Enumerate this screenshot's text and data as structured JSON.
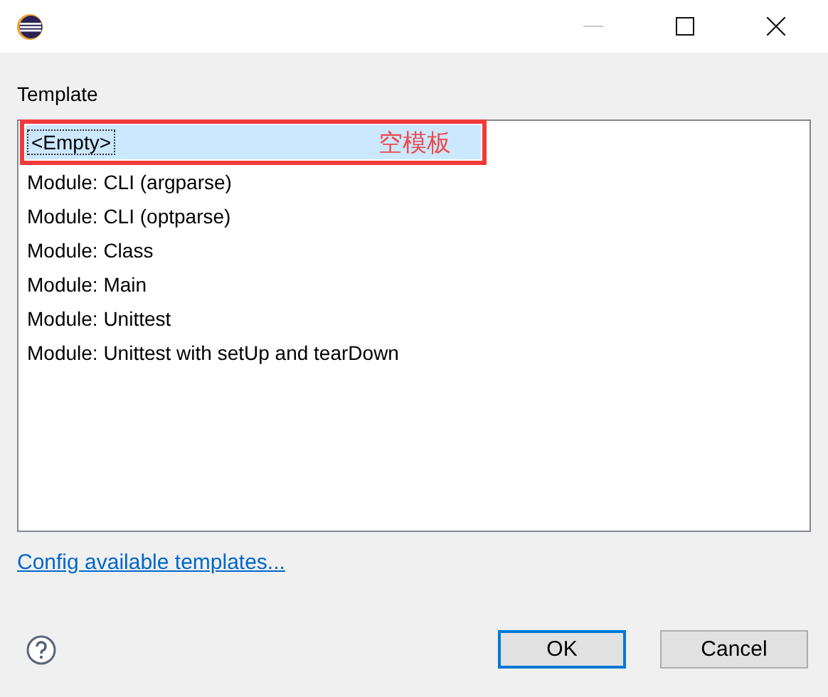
{
  "template_label": "Template",
  "templates": [
    {
      "label": "<Empty>",
      "selected": true
    },
    {
      "label": "Module: CLI (argparse)",
      "selected": false
    },
    {
      "label": "Module: CLI (optparse)",
      "selected": false
    },
    {
      "label": "Module: Class",
      "selected": false
    },
    {
      "label": "Module: Main",
      "selected": false
    },
    {
      "label": "Module: Unittest",
      "selected": false
    },
    {
      "label": "Module: Unittest with setUp and tearDown",
      "selected": false
    }
  ],
  "annotation": {
    "text": "空模板"
  },
  "config_link": "Config available templates...",
  "buttons": [
    {
      "label": "OK",
      "default": true
    },
    {
      "label": "Cancel",
      "default": false
    }
  ]
}
